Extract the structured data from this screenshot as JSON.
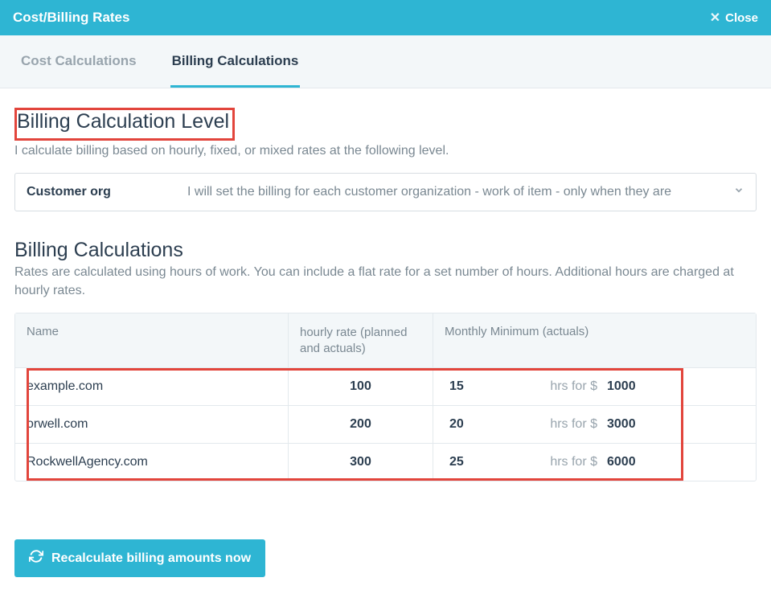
{
  "header": {
    "title": "Cost/Billing Rates",
    "close": "Close"
  },
  "tabs": {
    "cost": "Cost Calculations",
    "billing": "Billing Calculations"
  },
  "level": {
    "title": "Billing Calculation Level",
    "desc": "I calculate billing based on hourly, fixed, or mixed rates at the following level.",
    "selector_label": "Customer org",
    "selector_desc": "I will set the billing for each customer organization - work of item - only when they are"
  },
  "calc": {
    "title": "Billing Calculations",
    "desc": "Rates are calculated using hours of work. You can include a flat rate for a set number of hours. Additional hours are charged at hourly rates.",
    "col_name": "Name",
    "col_rate": "hourly rate (planned and actuals)",
    "col_min": "Monthly Minimum (actuals)",
    "hrs_for": "hrs for $"
  },
  "rows": [
    {
      "name": "example.com",
      "rate": "100",
      "hrs": "15",
      "amount": "1000"
    },
    {
      "name": "orwell.com",
      "rate": "200",
      "hrs": "20",
      "amount": "3000"
    },
    {
      "name": "RockwellAgency.com",
      "rate": "300",
      "hrs": "25",
      "amount": "6000"
    }
  ],
  "button": {
    "recalc": "Recalculate billing amounts now"
  }
}
